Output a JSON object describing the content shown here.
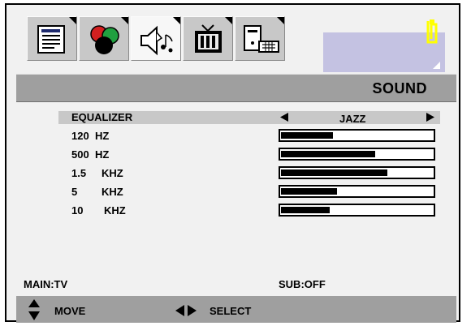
{
  "tabs": [
    {
      "icon": "document-list-icon",
      "active": false
    },
    {
      "icon": "color-balls-icon",
      "active": false
    },
    {
      "icon": "speaker-music-icon",
      "active": true
    },
    {
      "icon": "tv-icon",
      "active": false
    },
    {
      "icon": "pc-keyboard-icon",
      "active": false
    }
  ],
  "title": "SOUND",
  "equalizer": {
    "label": "EQUALIZER",
    "value": "JAZZ",
    "prev_icon": "triangle-left-icon",
    "next_icon": "triangle-right-icon"
  },
  "bands": [
    {
      "name": "120",
      "unit": "HZ",
      "level": 0.34
    },
    {
      "name": "500",
      "unit": "HZ",
      "level": 0.62
    },
    {
      "name": "1.5",
      "unit": "KHZ",
      "level": 0.7
    },
    {
      "name": "5",
      "unit": "KHZ",
      "level": 0.37
    },
    {
      "name": "10",
      "unit": "KHZ",
      "level": 0.32
    }
  ],
  "status": {
    "main": "MAIN:TV",
    "sub": "SUB:OFF"
  },
  "help": {
    "move_icon": "up-down-arrows-icon",
    "move_label": "MOVE",
    "select_icon": "left-right-arrows-icon",
    "select_label": "SELECT"
  },
  "colors": {
    "title_bar": "#9f9f9f",
    "highlight_row": "#c8c8c8",
    "panel": "#c4c2e2",
    "clip": "#ffff00"
  }
}
